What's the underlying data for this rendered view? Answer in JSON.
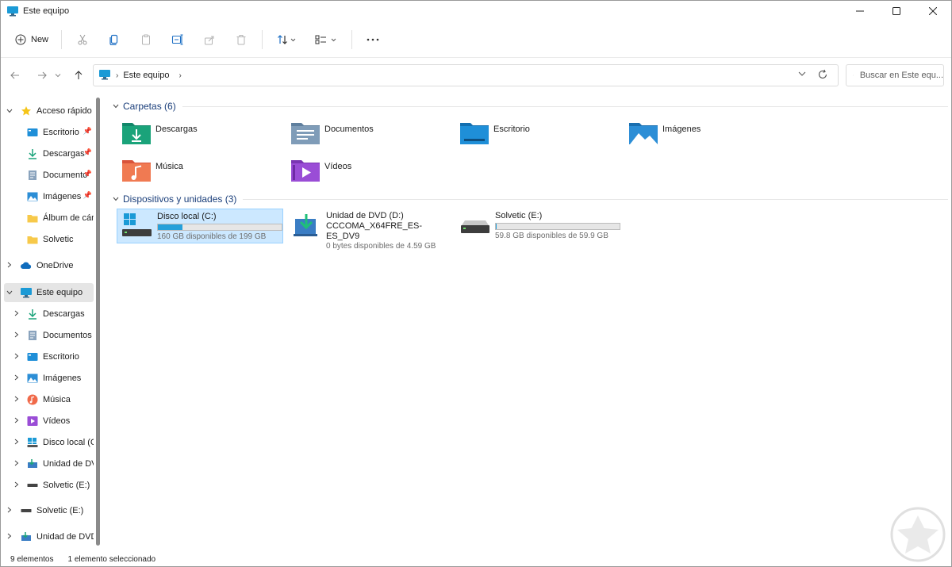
{
  "window": {
    "title": "Este equipo"
  },
  "commandbar": {
    "new_label": "New"
  },
  "address": {
    "breadcrumb": "Este equipo",
    "search_placeholder": "Buscar en Este equ..."
  },
  "sidebar": {
    "items": [
      {
        "label": "Acceso rápido",
        "level": 0,
        "icon": "star-icon",
        "expanded": true
      },
      {
        "label": "Escritorio",
        "level": 1,
        "icon": "desktop-folder-icon",
        "pinned": true
      },
      {
        "label": "Descargas",
        "level": 1,
        "icon": "download-icon",
        "pinned": true
      },
      {
        "label": "Documento",
        "level": 1,
        "icon": "documents-icon",
        "pinned": true
      },
      {
        "label": "Imágenes",
        "level": 1,
        "icon": "pictures-icon",
        "pinned": true
      },
      {
        "label": "Álbum de cáma",
        "level": 1,
        "icon": "folder-icon"
      },
      {
        "label": "Solvetic",
        "level": 1,
        "icon": "folder-icon"
      },
      {
        "label": "OneDrive",
        "level": 0,
        "icon": "cloud-icon"
      },
      {
        "label": "Este equipo",
        "level": 0,
        "icon": "computer-icon",
        "expanded": true,
        "selected": true
      },
      {
        "label": "Descargas",
        "level": 1,
        "icon": "download-icon"
      },
      {
        "label": "Documentos",
        "level": 1,
        "icon": "documents-icon"
      },
      {
        "label": "Escritorio",
        "level": 1,
        "icon": "desktop-folder-icon"
      },
      {
        "label": "Imágenes",
        "level": 1,
        "icon": "pictures-icon"
      },
      {
        "label": "Música",
        "level": 1,
        "icon": "music-icon"
      },
      {
        "label": "Vídeos",
        "level": 1,
        "icon": "videos-icon"
      },
      {
        "label": "Disco local (C:)",
        "level": 1,
        "icon": "windows-drive-icon"
      },
      {
        "label": "Unidad de DVD",
        "level": 1,
        "icon": "dvd-drive-icon"
      },
      {
        "label": "Solvetic (E:)",
        "level": 1,
        "icon": "usb-drive-icon"
      },
      {
        "label": "Solvetic (E:)",
        "level": 0,
        "icon": "usb-drive-icon"
      },
      {
        "label": "Unidad de DVD (",
        "level": 0,
        "icon": "dvd-drive-icon"
      }
    ]
  },
  "content": {
    "folders_header": "Carpetas (6)",
    "folders": [
      {
        "name": "Descargas",
        "icon": "downloads-folder-icon",
        "color": "#1aa37a"
      },
      {
        "name": "Documentos",
        "icon": "documents-folder-icon",
        "color": "#7f9cb8"
      },
      {
        "name": "Escritorio",
        "icon": "desktop-folder-icon",
        "color": "#1f8fd8"
      },
      {
        "name": "Imágenes",
        "icon": "pictures-folder-icon",
        "color": "#2c8ed6"
      },
      {
        "name": "Música",
        "icon": "music-folder-icon",
        "color": "#f06a4a"
      },
      {
        "name": "Vídeos",
        "icon": "videos-folder-icon",
        "color": "#9a4dd6"
      }
    ],
    "devices_header": "Dispositivos y unidades (3)",
    "devices": [
      {
        "name": "Disco local (C:)",
        "free": "160 GB disponibles de 199 GB",
        "used_fraction": 0.2,
        "selected": true
      },
      {
        "name": "Unidad de DVD (D:)",
        "subtitle": "CCCOMA_X64FRE_ES-ES_DV9",
        "free": "0 bytes disponibles de 4.59 GB"
      },
      {
        "name": "Solvetic (E:)",
        "free": "59.8 GB disponibles de 59.9 GB",
        "used_fraction": 0.002
      }
    ]
  },
  "status": {
    "count": "9 elementos",
    "selection": "1 elemento seleccionado"
  },
  "colors": {
    "accent": "#26a0da",
    "header_text": "#1a3e7a",
    "selection_bg": "#cce8ff"
  }
}
